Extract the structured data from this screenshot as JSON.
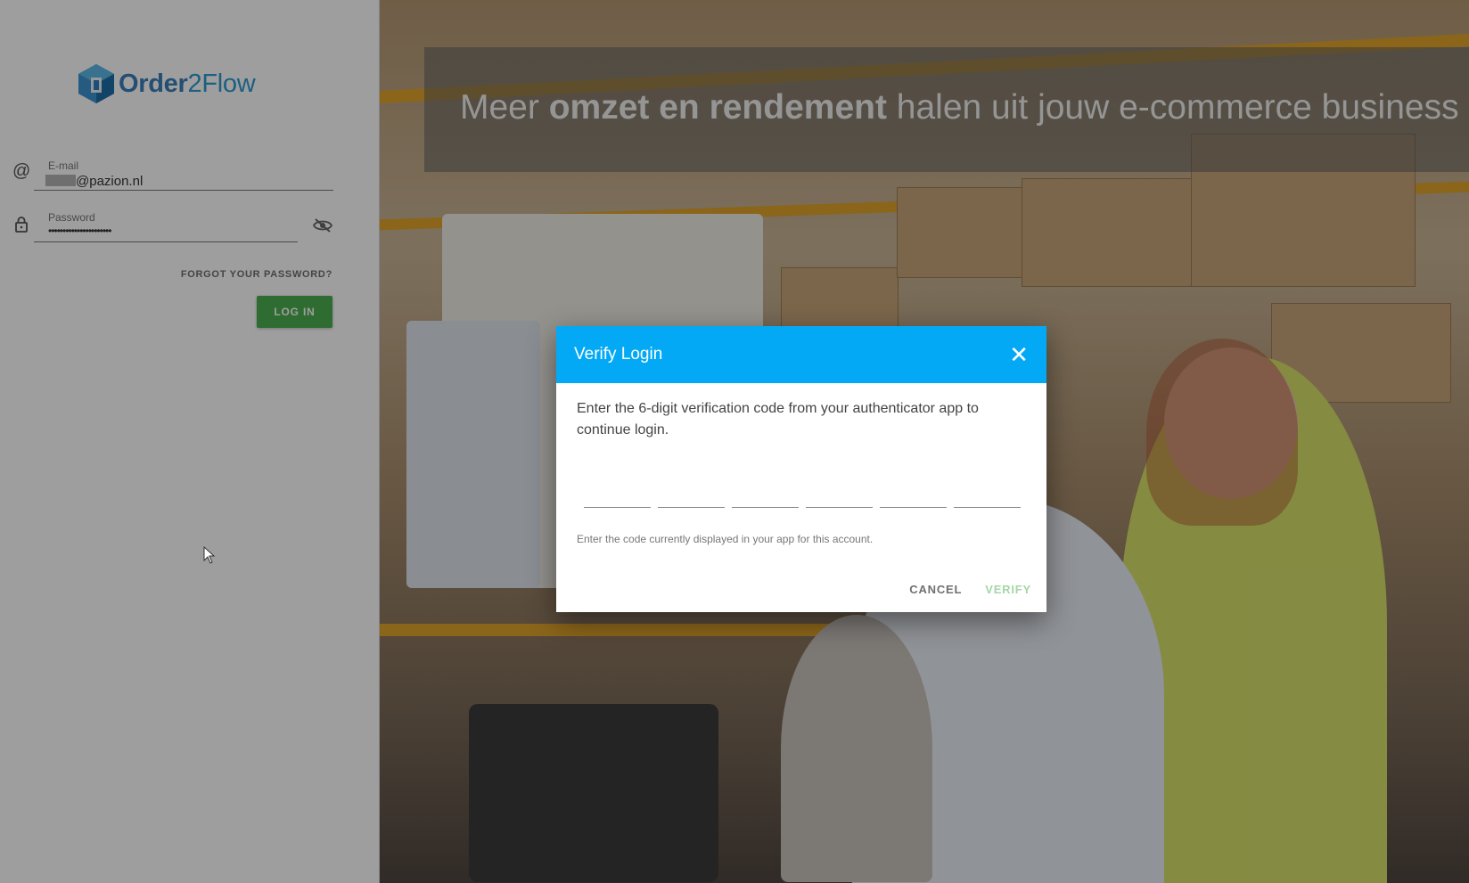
{
  "brand": {
    "name_part1": "Order",
    "name_part2": "2Flow"
  },
  "login": {
    "email_label": "E-mail",
    "email_value": "@pazion.nl",
    "password_label": "Password",
    "password_value": "••••••••••••••••••••••",
    "forgot_label": "FORGOT YOUR PASSWORD?",
    "login_button": "LOG IN"
  },
  "hero": {
    "tagline_pre": "Meer ",
    "tagline_bold": "omzet en rendement",
    "tagline_post": " halen uit jouw e-commerce business"
  },
  "dialog": {
    "title": "Verify Login",
    "close_icon": "close-icon",
    "instruction": "Enter the 6-digit verification code from your authenticator app to continue login.",
    "code_digits": [
      "",
      "",
      "",
      "",
      "",
      ""
    ],
    "hint": "Enter the code currently displayed in your app for this account.",
    "cancel_label": "CANCEL",
    "verify_label": "VERIFY"
  },
  "colors": {
    "header_accent": "#03a9f4",
    "login_button": "#4caf50",
    "verify_disabled": "#a5d6a7"
  },
  "icons": [
    "at-sign-icon",
    "lock-icon",
    "eye-off-icon",
    "close-icon",
    "logo-cube-icon"
  ]
}
